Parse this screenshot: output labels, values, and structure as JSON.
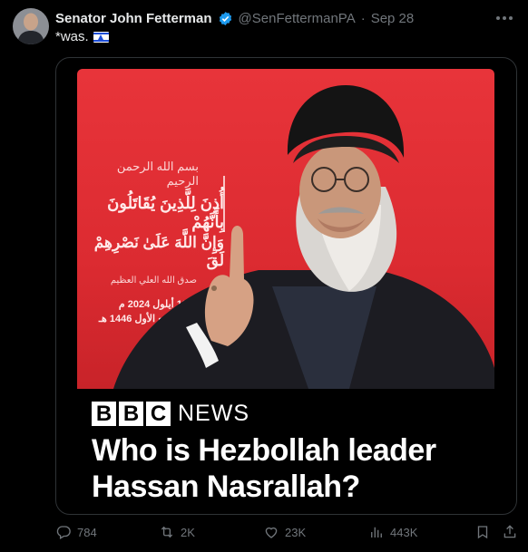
{
  "tweet": {
    "author_name": "Senator John Fetterman",
    "handle": "@SenFettermanPA",
    "separator": "·",
    "date": "Sep 28",
    "text": "*was."
  },
  "media": {
    "poster_arabic": {
      "ornament": "بسم الله الرحمن الرحيم",
      "line1": "أُذِنَ لِلَّذِينَ يُقَاتَلُونَ بِأَنَّهُمْ",
      "line2": "وَإِنَّ اللَّهَ عَلَىٰ نَصْرِهِمْ لَقَ",
      "line3": "صدق الله العلي العظيم",
      "line4": "19 أيلول 2024 م",
      "line5": "15 ربيع الأول 1446 هـ"
    },
    "logo_letters": [
      "B",
      "B",
      "C"
    ],
    "logo_word": "NEWS",
    "headline_line1": "Who is Hezbollah leader",
    "headline_line2": "Hassan Nasrallah?"
  },
  "actions": {
    "replies": "784",
    "reposts": "2K",
    "likes": "23K",
    "views": "443K"
  },
  "colors": {
    "background": "#000000",
    "text_primary": "#e7e9ea",
    "text_secondary": "#71767b",
    "verified": "#1d9bf0",
    "poster_red": "#dc2b31"
  },
  "icons": [
    "verified-badge-icon",
    "more-icon",
    "flag-israel-icon",
    "reply-icon",
    "repost-icon",
    "like-icon",
    "views-icon",
    "bookmark-icon",
    "share-icon"
  ]
}
